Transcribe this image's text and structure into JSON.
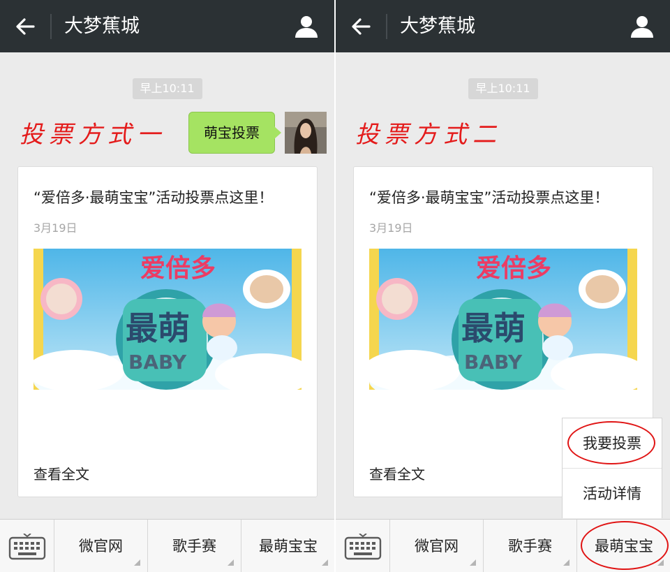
{
  "panes": [
    {
      "header": {
        "title": "大梦蕉城"
      },
      "timestamp": "早上10:11",
      "annotation": "投票方式一",
      "message": {
        "text": "萌宝投票"
      },
      "card": {
        "title": "“爱倍多·最萌宝宝”活动投票点这里！",
        "date": "3月19日",
        "read_more": "查看全文"
      },
      "bottom_menu": [
        "微官网",
        "歌手赛",
        "最萌宝宝"
      ]
    },
    {
      "header": {
        "title": "大梦蕉城"
      },
      "timestamp": "早上10:11",
      "annotation": "投票方式二",
      "card": {
        "title": "“爱倍多·最萌宝宝”活动投票点这里！",
        "date": "3月19日",
        "read_more": "查看全文"
      },
      "bottom_menu": [
        "微官网",
        "歌手赛",
        "最萌宝宝"
      ],
      "popup_menu": [
        "我要投票",
        "活动详情"
      ]
    }
  ],
  "banner_text": {
    "brand": "爱倍多",
    "main": "最萌",
    "sub": "BABY"
  },
  "icons": {
    "back": "arrow-left-icon",
    "user": "user-profile-icon",
    "keyboard": "keyboard-icon"
  },
  "colors": {
    "header_bg": "#2b3134",
    "bubble": "#a5e362",
    "annotation": "#e41b1b",
    "highlight_circle": "#e01414"
  }
}
